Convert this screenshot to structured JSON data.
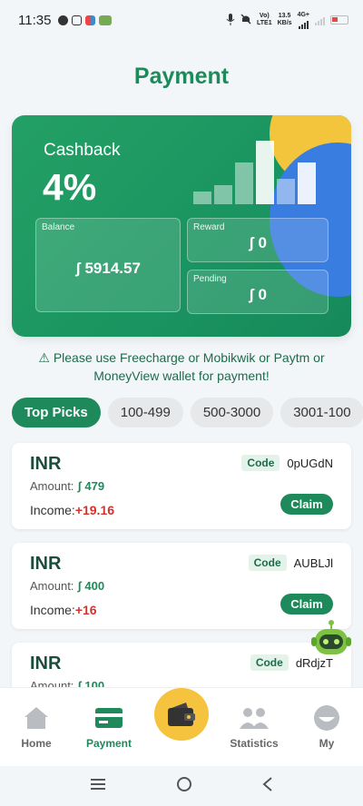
{
  "status_bar": {
    "time": "11:35",
    "net_label_top": "Vo)",
    "net_label_bottom": "LTE1",
    "speed_top": "13.5",
    "speed_bottom": "KB/s",
    "signal_label": "4G+"
  },
  "page": {
    "title": "Payment"
  },
  "card": {
    "cashback_label": "Cashback",
    "cashback_value": "4%",
    "balance_label": "Balance",
    "balance_value": "ʃ 5914.57",
    "reward_label": "Reward",
    "reward_value": "ʃ 0",
    "pending_label": "Pending",
    "pending_value": "ʃ 0",
    "bar_levels": [
      0.2,
      0.3,
      0.65,
      1.0,
      0.4,
      0.65
    ]
  },
  "notice": "⚠ Please use Freecharge or Mobikwik or Paytm or MoneyView wallet for payment!",
  "tabs": [
    "Top Picks",
    "100-499",
    "500-3000",
    "3001-100"
  ],
  "offers": [
    {
      "currency": "INR",
      "code_label": "Code",
      "code": "0pUGdN",
      "amount_label": "Amount:",
      "amount": "ʃ 479",
      "income_label": "Income:",
      "income": "+19.16",
      "claim": "Claim"
    },
    {
      "currency": "INR",
      "code_label": "Code",
      "code": "AUBLJl",
      "amount_label": "Amount:",
      "amount": "ʃ 400",
      "income_label": "Income:",
      "income": "+16",
      "claim": "Claim"
    },
    {
      "currency": "INR",
      "code_label": "Code",
      "code": "dRdjzT",
      "amount_label": "Amount:",
      "amount": "ʃ 100"
    }
  ],
  "nav": {
    "home": "Home",
    "payment": "Payment",
    "statistics": "Statistics",
    "my": "My"
  },
  "colors": {
    "accent": "#1e8a5b",
    "income": "#d0322e",
    "wallet": "#f5c33d"
  }
}
